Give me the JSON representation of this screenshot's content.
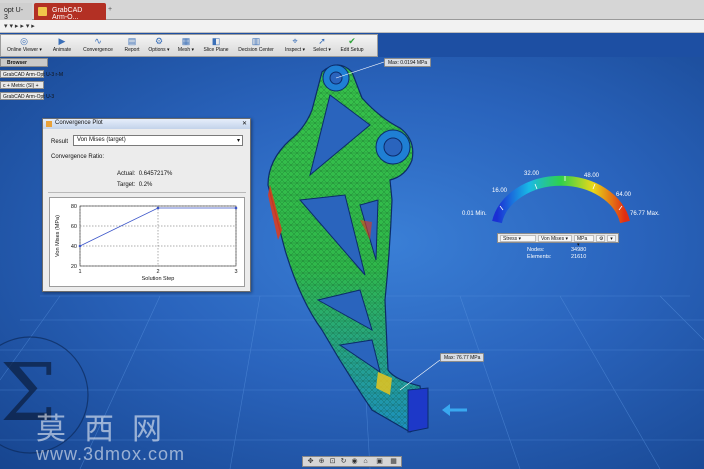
{
  "tabs": [
    {
      "label": "opt U-3",
      "active": false
    },
    {
      "label": "GrabCAD Arm-O...",
      "active": true
    },
    {
      "label": "+",
      "active": false
    }
  ],
  "address_bar": "▾ ▾ ▸ ▸  ▾ ▸",
  "ribbon": {
    "buttons": [
      {
        "label": "Online Viewer ▾",
        "icon": "viewer-icon",
        "glyph": "◎"
      },
      {
        "label": "Animate",
        "icon": "animate-icon",
        "glyph": "▶"
      },
      {
        "label": "Convergence",
        "icon": "convergence-icon",
        "glyph": "∿"
      },
      {
        "label": "Report",
        "icon": "report-icon",
        "glyph": "▤"
      },
      {
        "label": "Options ▾",
        "icon": "options-icon",
        "glyph": "⚙"
      },
      {
        "label": "Mesh ▾",
        "icon": "mesh-icon",
        "glyph": "▦"
      },
      {
        "label": "Slice Plane",
        "icon": "slice-plane-icon",
        "glyph": "◧"
      },
      {
        "label": "Decision Center",
        "icon": "decision-center-icon",
        "glyph": "▥"
      },
      {
        "label": "Inspect ▾",
        "icon": "inspect-icon",
        "glyph": "⌖"
      },
      {
        "label": "Select ▾",
        "icon": "select-icon",
        "glyph": "➚"
      },
      {
        "label": "Edit Setup",
        "icon": "edit-setup-icon",
        "glyph": "✔"
      }
    ]
  },
  "browser": {
    "title": "Browser",
    "items": [
      "GrabCAD Arm-Opt U-3 r-M",
      "c + Metric (SI) +",
      "GrabCAD Arm-Opt U-3"
    ]
  },
  "convergence": {
    "title": "Convergence Plot",
    "close": "✕",
    "result_label": "Result",
    "result_value": "Von Mises (target)",
    "rate_label": "Convergence Ratio:",
    "actual_label": "Actual:",
    "actual_value": "0.6457217%",
    "target_label": "Target:",
    "target_value": "0.2%"
  },
  "chart_data": {
    "type": "line",
    "title": "",
    "xlabel": "Solution Step",
    "ylabel": "Von Mises (MPa)",
    "x": [
      1,
      2,
      3
    ],
    "series": [
      {
        "values": [
          40,
          78,
          78
        ]
      }
    ],
    "xlim": [
      1,
      3
    ],
    "ylim": [
      20,
      80
    ],
    "yticks": [
      20,
      40,
      60,
      80
    ],
    "xticks": [
      1,
      2,
      3
    ],
    "grid": true,
    "line_color": "#3a54c9"
  },
  "legend": {
    "min_label": "0.01 Min.",
    "max_label": "76.77 Max.",
    "ticks": [
      "16.00",
      "32.00",
      "48.00",
      "64.00"
    ],
    "controls": [
      "Stress ▾",
      "Von Mises ▾",
      "MPa ▾"
    ],
    "nodes_label": "Nodes:",
    "nodes_value": "34980",
    "elements_label": "Elements:",
    "elements_value": "21610"
  },
  "callouts": {
    "max": "Max: 0.0194 MPa",
    "min": "Max: 76.77 MPa"
  },
  "watermark": {
    "chinese": "莫西网",
    "url": "www.3dmox.com"
  },
  "colors": {
    "viewport": "#2a64bd",
    "ribbon": "#e3e3e3",
    "active_tab": "#b33024"
  }
}
